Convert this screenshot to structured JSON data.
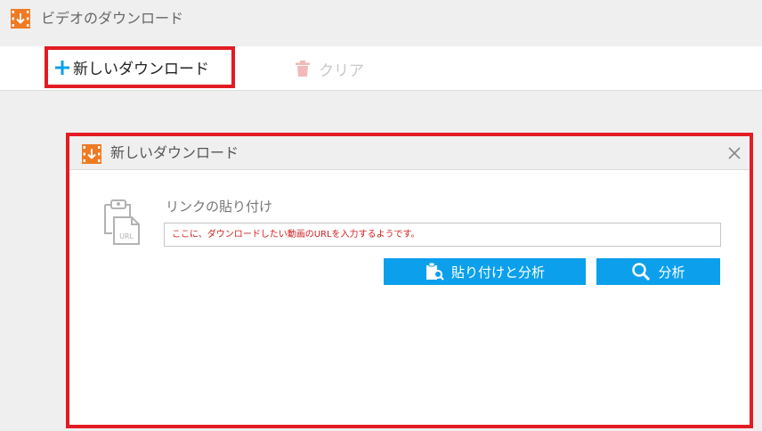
{
  "app": {
    "title": "ビデオのダウンロード"
  },
  "toolbar": {
    "new_download_label": "新しいダウンロード",
    "clear_label": "クリア"
  },
  "dialog": {
    "title": "新しいダウンロード",
    "link_label": "リンクの貼り付け",
    "url_placeholder": "ここに、ダウンロードしたい動画のURLを入力するようです。",
    "url_icon_text": "URL",
    "paste_analyze_label": "貼り付けと分析",
    "analyze_label": "分析"
  },
  "colors": {
    "accent": "#0ca0ec",
    "highlight": "#e31b23",
    "brand_orange": "#f07a22"
  },
  "icons": [
    "app-logo-icon",
    "plus-icon",
    "trash-icon",
    "close-icon",
    "url-clipboard-icon",
    "paste-search-icon",
    "search-icon"
  ]
}
